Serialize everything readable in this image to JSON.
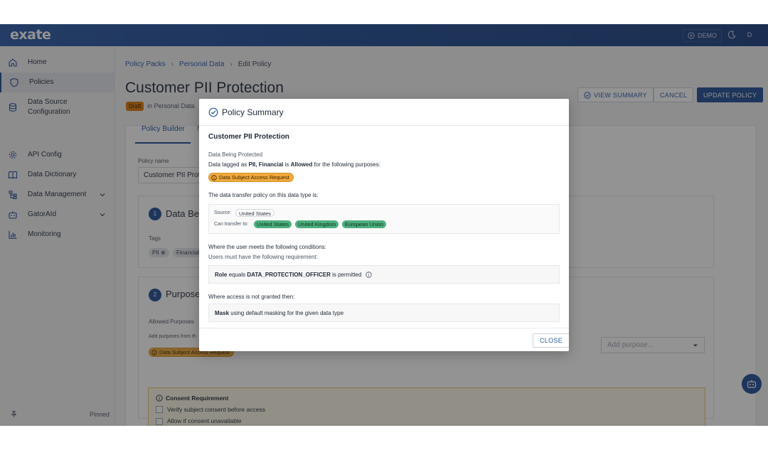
{
  "app": {
    "logo": "exate",
    "demo_label": "DEMO",
    "user_initial": "D"
  },
  "sidebar": {
    "items": [
      {
        "label": "Home",
        "icon": "home-icon"
      },
      {
        "label": "Policies",
        "icon": "shield-icon",
        "active": true
      },
      {
        "label": "Data Source Configuration",
        "icon": "database-icon"
      },
      {
        "label": "API Config",
        "icon": "gear-icon"
      },
      {
        "label": "Data Dictionary",
        "icon": "book-icon"
      },
      {
        "label": "Data Management",
        "icon": "hierarchy-icon",
        "expandable": true
      },
      {
        "label": "GatorAId",
        "icon": "robot-icon",
        "expandable": true
      },
      {
        "label": "Monitoring",
        "icon": "bar-chart-icon"
      }
    ],
    "pinned_label": "Pinned"
  },
  "breadcrumb": {
    "items": [
      "Policy Packs",
      "Personal Data"
    ],
    "current": "Edit Policy"
  },
  "page": {
    "title": "Customer PII Protection",
    "status_badge": "Draft",
    "status_sub": "in Personal Data",
    "view_summary_label": "VIEW SUMMARY",
    "cancel_label": "CANCEL",
    "update_label": "UPDATE POLICY"
  },
  "tabs": {
    "active": "Policy Builder",
    "second_partial": "N"
  },
  "form": {
    "policy_name_label": "Policy name",
    "policy_name_value": "Customer PII Protection",
    "section1_num": "1",
    "section1_title_partial": "Data Bein",
    "tags_label": "Tags",
    "tags": [
      "PII",
      "Financial"
    ],
    "section2_num": "2",
    "section2_title_partial": "Purpose",
    "allowed_purposes_label": "Allowed Purposes",
    "add_purposes_hint_partial": "Add purposes from th",
    "purpose_chip_partial": "Data Subject Access Request",
    "add_purpose_placeholder": "Add purpose...",
    "consent_title": "Consent Requirement",
    "consent_options": [
      "Verify subject consent before access",
      "Allow if consent unavailable"
    ]
  },
  "modal": {
    "title": "Policy Summary",
    "policy_name": "Customer PII Protection",
    "data_section_label": "Data Being Protected",
    "data_line_prefix": "Data tagged as",
    "data_tags": "PII, Financial",
    "data_line_is": "is",
    "data_status": "Allowed",
    "data_line_suffix": "for the following purposes:",
    "purpose_chip": "Data Subject Access Request",
    "transfer_intro": "The data transfer policy on this data type is:",
    "source_label": "Source:",
    "source_country": "United States",
    "transfer_label": "Can transfer to:",
    "transfer_countries": [
      "United States",
      "United Kingdom",
      "European Union"
    ],
    "conditions_intro": "Where the user meets the following conditions:",
    "conditions_sub": "Users must have the following requirement:",
    "condition_role": "Role",
    "condition_equals": "equals",
    "condition_value": "DATA_PROTECTION_OFFICER",
    "condition_suffix": "is permitted",
    "not_granted_intro": "Where access is not granted then:",
    "mask_label": "Mask",
    "mask_desc": "using default masking for the given data type",
    "close_label": "CLOSE"
  },
  "colors": {
    "brand": "#1f4c96",
    "purpose_chip": "#f0a93b",
    "country_chip": "#4caf7d",
    "draft_badge": "#d97706"
  }
}
